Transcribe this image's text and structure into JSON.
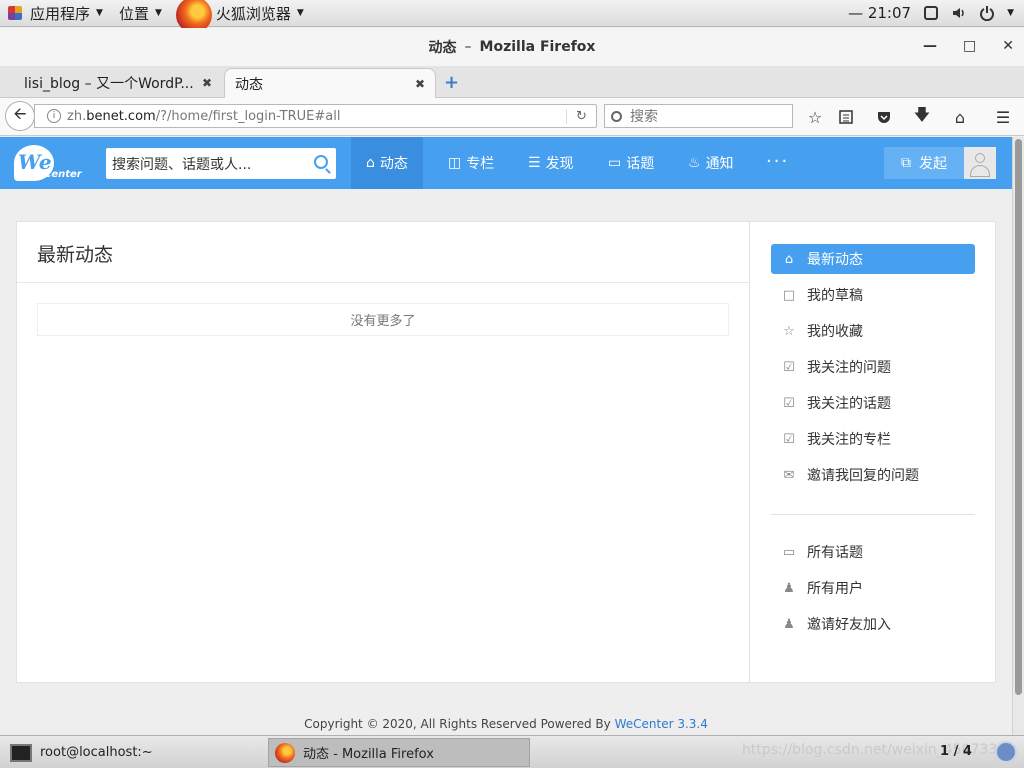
{
  "desktop": {
    "apps_menu": "应用程序",
    "places_menu": "位置",
    "browser_menu": "火狐浏览器",
    "clock": "21:07"
  },
  "window": {
    "title": "动态",
    "app": "Mozilla Firefox",
    "separator": "–"
  },
  "tabs": [
    {
      "label": "lisi_blog – 又一个WordP..."
    },
    {
      "label": "动态"
    }
  ],
  "navbar": {
    "url_prefix": "zh.",
    "url_host": "benet.com",
    "url_path": "/?/home/first_login-TRUE#all",
    "search_placeholder": "搜索"
  },
  "site": {
    "logo_we": "We",
    "logo_center": "Center",
    "search_placeholder": "搜索问题、话题或人...",
    "nav": [
      {
        "label": "动态",
        "icon": "home-icon"
      },
      {
        "label": "专栏",
        "icon": "columns-icon"
      },
      {
        "label": "发现",
        "icon": "list-icon"
      },
      {
        "label": "话题",
        "icon": "chat-icon"
      },
      {
        "label": "通知",
        "icon": "bell-icon"
      }
    ],
    "more": "···",
    "publish": "发起",
    "main_title": "最新动态",
    "no_more": "没有更多了",
    "sidebar": [
      {
        "label": "最新动态",
        "icon": "home-icon"
      },
      {
        "label": "我的草稿",
        "icon": "draft-icon"
      },
      {
        "label": "我的收藏",
        "icon": "star-icon"
      },
      {
        "label": "我关注的问题",
        "icon": "check-icon"
      },
      {
        "label": "我关注的话题",
        "icon": "check-icon"
      },
      {
        "label": "我关注的专栏",
        "icon": "check-icon"
      },
      {
        "label": "邀请我回复的问题",
        "icon": "mail-icon"
      },
      {
        "label": "所有话题",
        "icon": "chat-icon"
      },
      {
        "label": "所有用户",
        "icon": "user-icon"
      },
      {
        "label": "邀请好友加入",
        "icon": "add-user-icon"
      }
    ],
    "footer_text": "Copyright © 2020, All Rights Reserved Powered By",
    "footer_link": "WeCenter 3.3.4"
  },
  "taskbar": {
    "terminal": "root@localhost:~",
    "firefox": "动态 - Mozilla Firefox",
    "watermark": "https://blog.csdn.net/weixin_45073340",
    "pager": "1 / 4"
  }
}
